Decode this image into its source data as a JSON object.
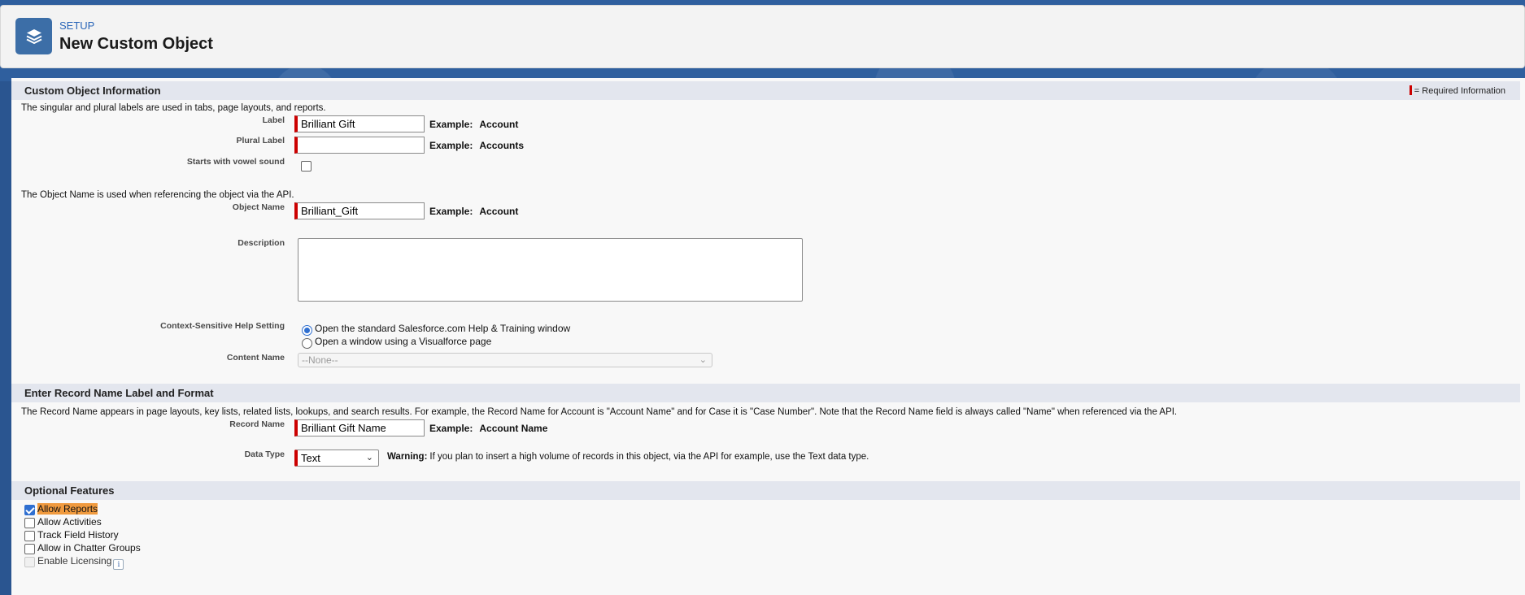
{
  "header": {
    "breadcrumb": "SETUP",
    "title": "New Custom Object",
    "icon": "stack-layers-icon"
  },
  "section1": {
    "title": "Custom Object Information",
    "required_info": "= Required Information",
    "help_labels": "The singular and plural labels are used in tabs, page layouts, and reports.",
    "label": {
      "label": "Label",
      "value": "Brilliant Gift",
      "example_prefix": "Example:",
      "example_value": "Account"
    },
    "plural": {
      "label": "Plural Label",
      "value": "",
      "example_prefix": "Example:",
      "example_value": "Accounts"
    },
    "vowel": {
      "label": "Starts with vowel sound",
      "checked": false
    },
    "help_object_name": "The Object Name is used when referencing the object via the API.",
    "object_name": {
      "label": "Object Name",
      "value": "Brilliant_Gift",
      "example_prefix": "Example:",
      "example_value": "Account"
    },
    "description": {
      "label": "Description",
      "value": ""
    },
    "help_setting": {
      "label": "Context-Sensitive Help Setting",
      "option1": "Open the standard Salesforce.com Help & Training window",
      "option2": "Open a window using a Visualforce page",
      "selected": "option1"
    },
    "content_name": {
      "label": "Content Name",
      "value": "--None--"
    }
  },
  "section2": {
    "title": "Enter Record Name Label and Format",
    "help": "The Record Name appears in page layouts, key lists, related lists, lookups, and search results. For example, the Record Name for Account is \"Account Name\" and for Case it is \"Case Number\". Note that the Record Name field is always called \"Name\" when referenced via the API.",
    "record_name": {
      "label": "Record Name",
      "value": "Brilliant Gift Name",
      "example_prefix": "Example:",
      "example_value": "Account Name"
    },
    "data_type": {
      "label": "Data Type",
      "value": "Text",
      "warning_prefix": "Warning:",
      "warning_text": "If you plan to insert a high volume of records in this object, via the API for example, use the Text data type."
    }
  },
  "section3": {
    "title": "Optional Features",
    "features": [
      {
        "label": "Allow Reports",
        "checked": true
      },
      {
        "label": "Allow Activities",
        "checked": false
      },
      {
        "label": "Track Field History",
        "checked": false
      },
      {
        "label": "Allow in Chatter Groups",
        "checked": false
      },
      {
        "label": "Enable Licensing",
        "checked": false,
        "disabled": true
      }
    ],
    "info_glyph": "i"
  },
  "colors": {
    "brand_blue": "#2f5f9e",
    "required_red": "#cc0000",
    "highlight_orange": "#f09a3e",
    "link_blue": "#2a66b8"
  }
}
